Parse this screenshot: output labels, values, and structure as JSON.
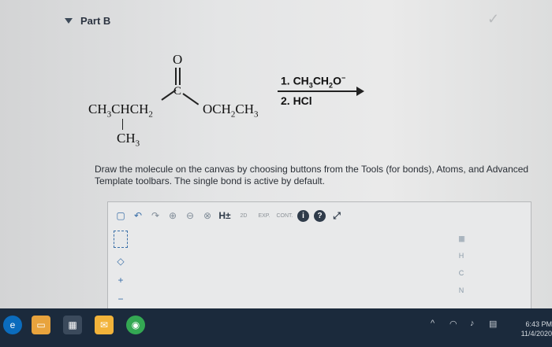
{
  "part": {
    "title": "Part B"
  },
  "molecule": {
    "carbonyl_o": "O",
    "carbonyl_c": "C",
    "left_chain_main": "CH",
    "left_chain_sub1": "3",
    "left_chain_mid": "CHCH",
    "left_chain_sub2": "2",
    "branch_main": "CH",
    "branch_sub": "3",
    "ester_main": "OCH",
    "ester_sub1": "2",
    "ester_mid": "CH",
    "ester_sub2": "3"
  },
  "reagents": {
    "step1_prefix": "1. CH",
    "step1_sub1": "3",
    "step1_mid": "CH",
    "step1_sub2": "2",
    "step1_o": "O",
    "step1_charge": "−",
    "step2": "2. HCl"
  },
  "instructions": "Draw the molecule on the canvas by choosing buttons from the Tools (for bonds), Atoms, and Advanced Template toolbars. The single bond is active by default.",
  "editor": {
    "toolbar": {
      "h_button": "H±",
      "two_d_label": "2D",
      "exp_label": "EXP.",
      "cont_label": "CONT.",
      "info_label": "i",
      "help_label": "?"
    },
    "left_tools": {
      "plus": "+",
      "minus": "−"
    },
    "atoms": {
      "periodic_label": "|||||||",
      "h": "H",
      "c": "C",
      "n": "N"
    }
  },
  "taskbar": {
    "time": "6:43 PM",
    "date": "11/4/2020"
  }
}
